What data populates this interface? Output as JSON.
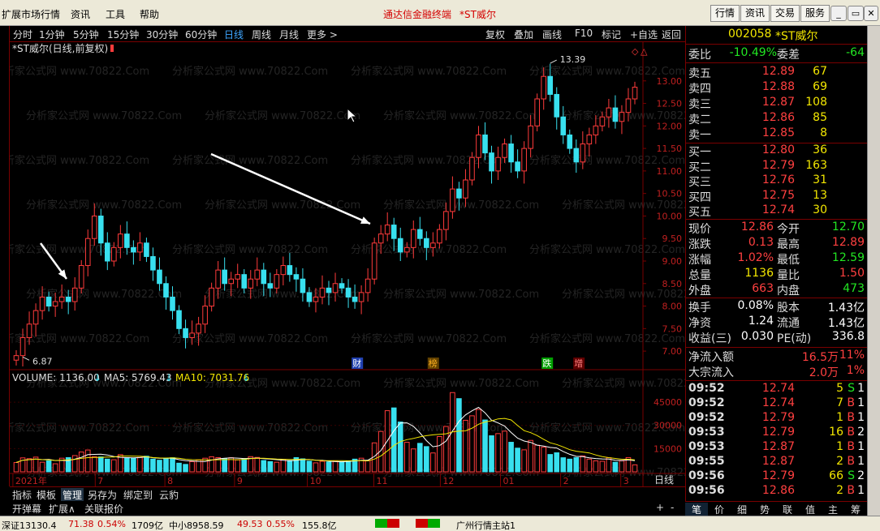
{
  "menu": {
    "items": [
      "扩展市场行情",
      "资讯",
      "工具",
      "帮助"
    ],
    "title": "通达信金融终端",
    "stock_title": "*ST威尔",
    "right_buttons": [
      "行情",
      "资讯",
      "交易",
      "服务"
    ]
  },
  "toolbar": {
    "periods": [
      "分时",
      "1分钟",
      "5分钟",
      "15分钟",
      "30分钟",
      "60分钟",
      "日线",
      "周线",
      "月线",
      "更多 >"
    ],
    "active": "日线",
    "tools": [
      "复权",
      "叠加",
      "画线",
      "F10",
      "标记",
      "+自选",
      "返回"
    ]
  },
  "chart": {
    "label": "*ST威尔(日线,前复权)",
    "watermark": "分析家公式网 www.70822.Com",
    "high_label": "13.39",
    "low_label": "6.87",
    "events": [
      "财",
      "榜",
      "跌",
      "增"
    ],
    "x_labels": [
      "2021年",
      "7",
      "8",
      "9",
      "10",
      "11",
      "12",
      "01",
      "2",
      "3"
    ],
    "period_label": "日线",
    "colors": {
      "up": "#ff3b3b",
      "down": "#38e0ef",
      "ma5": "#ffffff",
      "ma10": "#f2e600",
      "border": "#7a0000"
    }
  },
  "volume": {
    "label": "VOLUME: 1136.00",
    "ma5_label": "MA5: 5769.43",
    "ma10_label": "MA10: 7031.76"
  },
  "chart_data": [
    {
      "type": "candlestick",
      "title": "*ST威尔(日线,前复权)",
      "y_ticks": [
        7.0,
        7.5,
        8.0,
        8.5,
        9.0,
        9.5,
        10.0,
        10.5,
        11.0,
        11.5,
        12.0,
        12.5,
        13.0
      ],
      "ylim": [
        6.75,
        13.5
      ],
      "period": "2021年6月 - 2022年3月",
      "close": [
        6.9,
        7.3,
        7.6,
        7.9,
        8.2,
        8.0,
        8.1,
        8.2,
        8.1,
        8.4,
        8.9,
        9.5,
        10.0,
        9.4,
        9.0,
        9.3,
        9.6,
        9.3,
        9.2,
        9.4,
        9.1,
        8.8,
        8.5,
        8.2,
        7.9,
        7.5,
        7.3,
        7.4,
        7.6,
        8.0,
        8.4,
        8.8,
        8.5,
        8.6,
        8.7,
        8.4,
        8.6,
        8.8,
        8.5,
        8.4,
        8.7,
        8.9,
        8.7,
        8.6,
        8.3,
        8.1,
        8.2,
        8.4,
        8.3,
        8.5,
        8.4,
        8.2,
        8.1,
        8.3,
        8.6,
        9.4,
        9.6,
        9.8,
        9.5,
        9.2,
        9.3,
        9.7,
        9.5,
        9.3,
        9.4,
        9.7,
        10.1,
        10.6,
        10.4,
        10.8,
        11.3,
        11.8,
        11.4,
        11.0,
        11.3,
        11.6,
        11.2,
        11.0,
        11.5,
        12.0,
        12.6,
        13.1,
        12.7,
        12.2,
        11.8,
        11.5,
        11.2,
        11.6,
        11.8,
        12.0,
        12.2,
        12.4,
        12.1,
        12.3,
        12.6,
        12.86
      ],
      "high_marker": 13.39,
      "low_marker": 6.87
    },
    {
      "type": "bar",
      "title": "VOLUME",
      "y_ticks": [
        15000,
        30000,
        45000
      ],
      "ylim": [
        0,
        55000
      ],
      "values": [
        6000,
        9000,
        8500,
        9500,
        6200,
        7100,
        5200,
        8800,
        9200,
        10500,
        12800,
        14100,
        9800,
        9600,
        8200,
        7800,
        11100,
        9200,
        8700,
        9300,
        10100,
        8200,
        7500,
        8900,
        9100,
        5600,
        4800,
        6600,
        7700,
        8800,
        9700,
        9200,
        8600,
        9100,
        7700,
        8300,
        9800,
        9300,
        7300,
        6600,
        6200,
        8100,
        7300,
        9200,
        8400,
        6900,
        5800,
        6800,
        6400,
        7100,
        6500,
        6900,
        8200,
        8800,
        7100,
        18700,
        26100,
        39500,
        41300,
        32200,
        19100,
        14800,
        18400,
        16300,
        12200,
        22800,
        29300,
        51200,
        47300,
        33300,
        36200,
        40300,
        33500,
        23300,
        24700,
        26300,
        19100,
        15300,
        14200,
        20300,
        17200,
        15900,
        11200,
        12300,
        9100,
        8200,
        9200,
        10300,
        8200,
        7100,
        6800,
        9100,
        6200,
        7100,
        9200,
        4500
      ],
      "ma5_last": 5769.43,
      "ma10_last": 7031.76
    }
  ],
  "quote": {
    "code": "002058",
    "name": "*ST威尔",
    "weibi_label": "委比",
    "weibi": "-10.49%",
    "weicha_label": "委差",
    "weicha": "-64",
    "sell": [
      {
        "label": "卖五",
        "price": "12.89",
        "vol": "67"
      },
      {
        "label": "卖四",
        "price": "12.88",
        "vol": "69"
      },
      {
        "label": "卖三",
        "price": "12.87",
        "vol": "108"
      },
      {
        "label": "卖二",
        "price": "12.86",
        "vol": "85"
      },
      {
        "label": "卖一",
        "price": "12.85",
        "vol": "8"
      }
    ],
    "buy": [
      {
        "label": "买一",
        "price": "12.80",
        "vol": "36"
      },
      {
        "label": "买二",
        "price": "12.79",
        "vol": "163"
      },
      {
        "label": "买三",
        "price": "12.76",
        "vol": "31"
      },
      {
        "label": "买四",
        "price": "12.75",
        "vol": "13"
      },
      {
        "label": "买五",
        "price": "12.74",
        "vol": "30"
      }
    ],
    "stats": [
      {
        "l1": "现价",
        "v1": "12.86",
        "c1": "red",
        "l2": "今开",
        "v2": "12.70",
        "c2": "green"
      },
      {
        "l1": "涨跌",
        "v1": "0.13",
        "c1": "red",
        "l2": "最高",
        "v2": "12.89",
        "c2": "red"
      },
      {
        "l1": "涨幅",
        "v1": "1.02%",
        "c1": "red",
        "l2": "最低",
        "v2": "12.59",
        "c2": "green"
      },
      {
        "l1": "总量",
        "v1": "1136",
        "c1": "yellow",
        "l2": "量比",
        "v2": "1.50",
        "c2": "red"
      },
      {
        "l1": "外盘",
        "v1": "663",
        "c1": "red",
        "l2": "内盘",
        "v2": "473",
        "c2": "green"
      }
    ],
    "fin": [
      {
        "l1": "换手",
        "v1": "0.08%",
        "l2": "股本",
        "v2": "1.43亿"
      },
      {
        "l1": "净资",
        "v1": "1.24",
        "l2": "流通",
        "v2": "1.43亿"
      },
      {
        "l1": "收益(三)",
        "v1": "0.030",
        "l2": "PE(动)",
        "v2": "336.8"
      }
    ],
    "flow": [
      {
        "label": "净流入额",
        "value": "16.5万",
        "pct": "11%"
      },
      {
        "label": "大宗流入",
        "value": "2.0万",
        "pct": "1%"
      }
    ],
    "ticks": [
      {
        "time": "09:52",
        "price": "12.74",
        "vol": "5",
        "bs": "S",
        "n": "1"
      },
      {
        "time": "09:52",
        "price": "12.74",
        "vol": "7",
        "bs": "B",
        "n": "1"
      },
      {
        "time": "09:52",
        "price": "12.79",
        "vol": "1",
        "bs": "B",
        "n": "1"
      },
      {
        "time": "09:53",
        "price": "12.79",
        "vol": "16",
        "bs": "B",
        "n": "2"
      },
      {
        "time": "09:53",
        "price": "12.87",
        "vol": "1",
        "bs": "B",
        "n": "1"
      },
      {
        "time": "09:55",
        "price": "12.87",
        "vol": "2",
        "bs": "B",
        "n": "1"
      },
      {
        "time": "09:56",
        "price": "12.79",
        "vol": "66",
        "bs": "S",
        "n": "2"
      },
      {
        "time": "09:56",
        "price": "12.86",
        "vol": "2",
        "bs": "B",
        "n": "1"
      }
    ],
    "tabs": [
      "笔",
      "价",
      "细",
      "势",
      "联",
      "值",
      "主",
      "筹"
    ]
  },
  "bottom_tabs1": [
    "指标",
    "模板",
    "管理",
    "另存为",
    "绑定到",
    "云豹"
  ],
  "bottom_tabs1_active": "管理",
  "bottom_tabs2": [
    "开弹幕",
    "扩展∧",
    "关联报价"
  ],
  "zoom_controls": [
    "+",
    "-",
    "0"
  ],
  "status": {
    "idx1": "深证13130.4",
    "idx1_chg": "71.38",
    "idx1_pct": "0.54%",
    "idx1_amt": "1709亿",
    "idx2": "中小8958.59",
    "idx2_chg": "49.53",
    "idx2_pct": "0.55%",
    "idx2_amt": "155.8亿",
    "server": "广州行情主站1"
  }
}
